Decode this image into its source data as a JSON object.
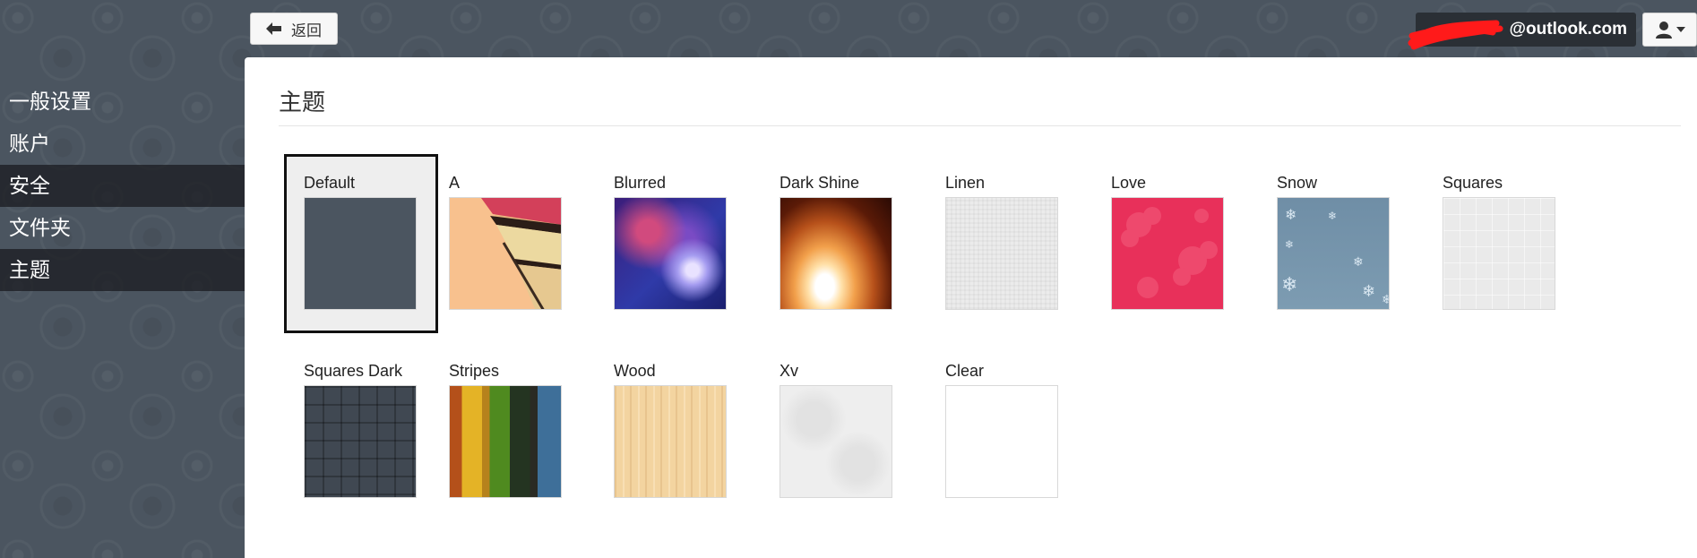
{
  "header": {
    "back_label": "返回",
    "account_email": "@outlook.com"
  },
  "sidebar": {
    "items": [
      {
        "label": "一般设置",
        "active": false
      },
      {
        "label": "账户",
        "active": false
      },
      {
        "label": "安全",
        "active": true
      },
      {
        "label": "文件夹",
        "active": false
      },
      {
        "label": "主题",
        "active": true
      }
    ]
  },
  "main": {
    "title": "主题",
    "selected_theme": "Default",
    "themes": [
      {
        "label": "Default"
      },
      {
        "label": "A"
      },
      {
        "label": "Blurred"
      },
      {
        "label": "Dark Shine"
      },
      {
        "label": "Linen"
      },
      {
        "label": "Love"
      },
      {
        "label": "Snow"
      },
      {
        "label": "Squares"
      },
      {
        "label": "Squares Dark"
      },
      {
        "label": "Stripes"
      },
      {
        "label": "Wood"
      },
      {
        "label": "Xv"
      },
      {
        "label": "Clear"
      }
    ]
  },
  "colors": {
    "sidebar_bg": "#4b5560",
    "active_item_bg": "#1c1e22",
    "selected_border": "#111111"
  }
}
